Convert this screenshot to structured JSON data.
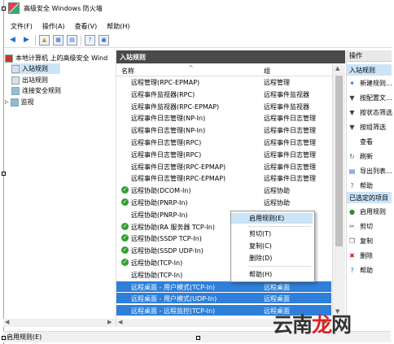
{
  "window": {
    "title": "高级安全 Windows 防火墙"
  },
  "menu": [
    "文件(F)",
    "操作(A)",
    "查看(V)",
    "帮助(H)"
  ],
  "toolbar": {
    "buttons": [
      "back-icon",
      "forward-icon",
      "up-folder-icon",
      "show-hide-tree-icon",
      "properties-icon",
      "help-icon",
      "console-icon"
    ]
  },
  "tree": {
    "root": "本地计算机 上的高级安全 Wind",
    "items": [
      "入站规则",
      "出站规则",
      "连接安全规则",
      "监视"
    ]
  },
  "center": {
    "header": "入站规则",
    "col_name": "名称",
    "col_group": "组",
    "rows": [
      {
        "name": "远程管理(RPC-EPMAP)",
        "group": "远程管理",
        "enabled": false
      },
      {
        "name": "远程事件监视器(RPC)",
        "group": "远程事件监视器",
        "enabled": false
      },
      {
        "name": "远程事件监视器(RPC-EPMAP)",
        "group": "远程事件监视器",
        "enabled": false
      },
      {
        "name": "远程事件日志管理(NP-In)",
        "group": "远程事件日志管理",
        "enabled": false
      },
      {
        "name": "远程事件日志管理(NP-In)",
        "group": "远程事件日志管理",
        "enabled": false
      },
      {
        "name": "远程事件日志管理(RPC)",
        "group": "远程事件日志管理",
        "enabled": false
      },
      {
        "name": "远程事件日志管理(RPC)",
        "group": "远程事件日志管理",
        "enabled": false
      },
      {
        "name": "远程事件日志管理(RPC-EPMAP)",
        "group": "远程事件日志管理",
        "enabled": false
      },
      {
        "name": "远程事件日志管理(RPC-EPMAP)",
        "group": "远程事件日志管理",
        "enabled": false
      },
      {
        "name": "远程协助(DCOM-In)",
        "group": "远程协助",
        "enabled": true
      },
      {
        "name": "远程协助(PNRP-In)",
        "group": "远程协助",
        "enabled": true
      },
      {
        "name": "远程协助(PNRP-In)",
        "group": "远程协助",
        "enabled": false
      },
      {
        "name": "远程协助(RA 服务器 TCP-In)",
        "group": "远程协助",
        "enabled": true
      },
      {
        "name": "远程协助(SSDP TCP-In)",
        "group": "远程协助",
        "enabled": true
      },
      {
        "name": "远程协助(SSDP UDP-In)",
        "group": "远程协助",
        "enabled": true
      },
      {
        "name": "远程协助(TCP-In)",
        "group": "远程协助",
        "enabled": true
      },
      {
        "name": "远程协助(TCP-In)",
        "group": "远程协助",
        "enabled": false
      },
      {
        "name": "远程桌面 - 用户模式(TCP-In)",
        "group": "远程桌面",
        "enabled": false,
        "selected": true
      },
      {
        "name": "远程桌面 - 用户模式(UDP-In)",
        "group": "远程桌面",
        "enabled": false,
        "selected": true
      },
      {
        "name": "远程桌面 - 远程监控(TCP-In)",
        "group": "远程桌面",
        "enabled": false,
        "selected": true
      }
    ]
  },
  "actions": {
    "header": "操作",
    "section1": "入站规则",
    "items1": [
      {
        "label": "新建规则...",
        "icon": "new-rule-icon"
      },
      {
        "label": "按配置文...",
        "icon": "filter-profile-icon"
      },
      {
        "label": "按状态筛选",
        "icon": "filter-state-icon"
      },
      {
        "label": "按组筛选",
        "icon": "filter-group-icon"
      },
      {
        "label": "查看",
        "icon": ""
      },
      {
        "label": "刷新",
        "icon": "refresh-icon"
      },
      {
        "label": "导出列表...",
        "icon": "export-icon"
      },
      {
        "label": "帮助",
        "icon": "help-icon"
      }
    ],
    "section2": "已选定的项目",
    "items2": [
      {
        "label": "启用规则",
        "icon": "enable-icon"
      },
      {
        "label": "剪切",
        "icon": "cut-icon"
      },
      {
        "label": "复制",
        "icon": "copy-icon"
      },
      {
        "label": "删除",
        "icon": "delete-icon"
      },
      {
        "label": "帮助",
        "icon": "help-icon"
      }
    ]
  },
  "context_menu": {
    "items": [
      "启用规则(E)",
      "剪切(T)",
      "复制(C)",
      "删除(D)",
      "帮助(H)"
    ]
  },
  "status": "启用规则(E)",
  "watermark": "云南龙网"
}
